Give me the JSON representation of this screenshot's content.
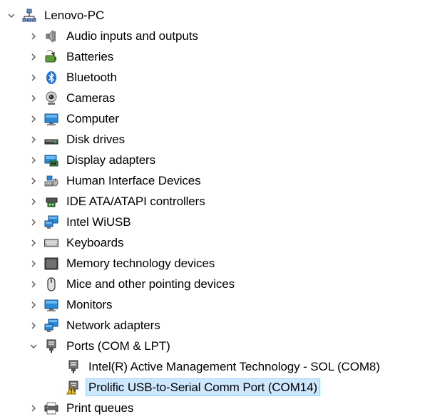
{
  "tree": {
    "root": {
      "label": "Lenovo-PC",
      "icon": "computer-tree-icon",
      "expanded": true
    },
    "items": [
      {
        "label": "Audio inputs and outputs",
        "icon": "speaker-icon",
        "expanded": false
      },
      {
        "label": "Batteries",
        "icon": "battery-icon",
        "expanded": false
      },
      {
        "label": "Bluetooth",
        "icon": "bluetooth-icon",
        "expanded": false
      },
      {
        "label": "Cameras",
        "icon": "webcam-icon",
        "expanded": false
      },
      {
        "label": "Computer",
        "icon": "monitor-icon",
        "expanded": false
      },
      {
        "label": "Disk drives",
        "icon": "disk-drive-icon",
        "expanded": false
      },
      {
        "label": "Display adapters",
        "icon": "display-adapter-icon",
        "expanded": false
      },
      {
        "label": "Human Interface Devices",
        "icon": "hid-icon",
        "expanded": false
      },
      {
        "label": "IDE ATA/ATAPI controllers",
        "icon": "ide-controller-icon",
        "expanded": false
      },
      {
        "label": "Intel WiUSB",
        "icon": "network-monitor-icon",
        "expanded": false
      },
      {
        "label": "Keyboards",
        "icon": "keyboard-icon",
        "expanded": false
      },
      {
        "label": "Memory technology devices",
        "icon": "memory-device-icon",
        "expanded": false
      },
      {
        "label": "Mice and other pointing devices",
        "icon": "mouse-icon",
        "expanded": false
      },
      {
        "label": "Monitors",
        "icon": "monitor-icon",
        "expanded": false
      },
      {
        "label": "Network adapters",
        "icon": "network-monitor-icon",
        "expanded": false
      },
      {
        "label": "Ports (COM & LPT)",
        "icon": "port-icon",
        "expanded": true,
        "children": [
          {
            "label": "Intel(R) Active Management Technology - SOL (COM8)",
            "icon": "port-icon"
          },
          {
            "label": "Prolific USB-to-Serial Comm Port (COM14)",
            "icon": "port-warning-icon",
            "selected": true
          }
        ]
      },
      {
        "label": "Print queues",
        "icon": "printer-icon",
        "expanded": false
      }
    ]
  },
  "colors": {
    "selection_bg": "#cce8ff",
    "selection_border": "#99d1ff",
    "chevron": "#555555",
    "warning": "#f5c400"
  }
}
